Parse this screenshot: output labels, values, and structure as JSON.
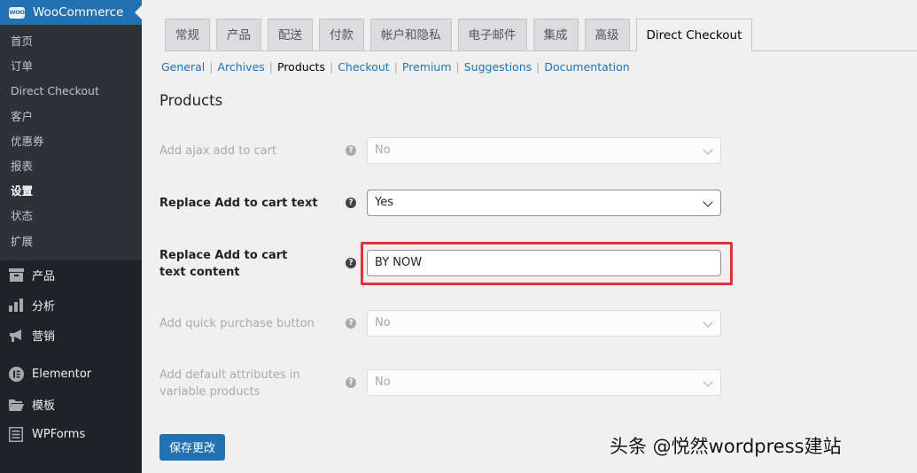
{
  "sidebar": {
    "brand": "WooCommerce",
    "logo_text": "WOO",
    "submenu": [
      {
        "label": "首页"
      },
      {
        "label": "订单"
      },
      {
        "label": "Direct Checkout"
      },
      {
        "label": "客户"
      },
      {
        "label": "优惠券"
      },
      {
        "label": "报表"
      },
      {
        "label": "设置",
        "active": true
      },
      {
        "label": "状态"
      },
      {
        "label": "扩展"
      }
    ],
    "menu": [
      {
        "label": "产品",
        "icon": "archive-icon"
      },
      {
        "label": "分析",
        "icon": "bar-chart-icon"
      },
      {
        "label": "营销",
        "icon": "megaphone-icon"
      },
      {
        "label": "Elementor",
        "icon": "elementor-icon"
      },
      {
        "label": "模板",
        "icon": "folder-icon"
      },
      {
        "label": "WPForms",
        "icon": "form-icon"
      }
    ]
  },
  "tabs": [
    {
      "label": "常规"
    },
    {
      "label": "产品"
    },
    {
      "label": "配送"
    },
    {
      "label": "付款"
    },
    {
      "label": "帐户和隐私"
    },
    {
      "label": "电子邮件"
    },
    {
      "label": "集成"
    },
    {
      "label": "高级"
    },
    {
      "label": "Direct Checkout",
      "active": true
    }
  ],
  "subnav": [
    {
      "label": "General"
    },
    {
      "label": "Archives"
    },
    {
      "label": "Products",
      "current": true
    },
    {
      "label": "Checkout"
    },
    {
      "label": "Premium"
    },
    {
      "label": "Suggestions"
    },
    {
      "label": "Documentation"
    }
  ],
  "section_title": "Products",
  "fields": {
    "ajax_add_to_cart": {
      "label": "Add ajax add to cart",
      "value": "No",
      "disabled": true
    },
    "replace_text": {
      "label": "Replace Add to cart text",
      "value": "Yes",
      "disabled": false
    },
    "replace_text_content": {
      "label": "Replace Add to cart text content",
      "value": "BY NOW"
    },
    "quick_purchase": {
      "label": "Add quick purchase button",
      "value": "No",
      "disabled": true
    },
    "default_attributes": {
      "label": "Add default attributes in variable products",
      "value": "No",
      "disabled": true
    }
  },
  "help_glyph": "?",
  "save_button": "保存更改",
  "watermark": "头条 @悦然wordpress建站",
  "colors": {
    "accent": "#2271b1",
    "sidebar_bg": "#1d2327",
    "highlight": "#d63638"
  }
}
